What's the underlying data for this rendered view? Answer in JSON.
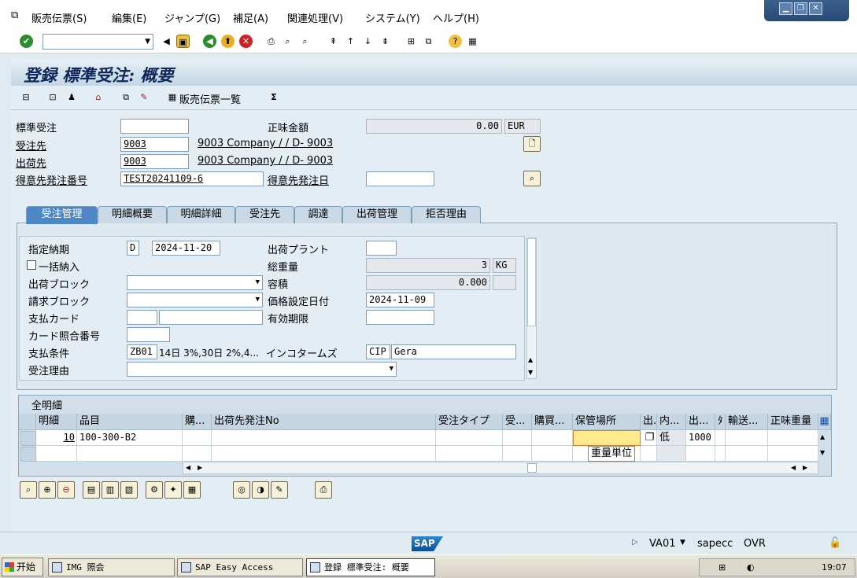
{
  "menu": [
    "販売伝票(S)",
    "編集(E)",
    "ジャンプ(G)",
    "補足(A)",
    "関連処理(V)",
    "システム(Y)",
    "ヘルプ(H)"
  ],
  "page_title": "登録 標準受注: 概要",
  "appbar": {
    "list_label": "販売伝票一覧"
  },
  "header": {
    "order_type_label": "標準受注",
    "order_type_value": "",
    "net_value_label": "正味金額",
    "net_value": "0.00",
    "currency": "EUR",
    "sold_to_label": "受注先",
    "sold_to_value": "9003",
    "sold_to_desc": "9003 Company / / D- 9003",
    "ship_to_label": "出荷先",
    "ship_to_value": "9003",
    "ship_to_desc": "9003 Company / / D- 9003",
    "po_number_label": "得意先発注番号",
    "po_number_value": "TEST20241109-6",
    "po_date_label": "得意先発注日",
    "po_date_value": ""
  },
  "tabs": [
    "受注管理",
    "明細概要",
    "明細詳細",
    "受注先",
    "調達",
    "出荷管理",
    "拒否理由"
  ],
  "sales_tab": {
    "req_delivery_label": "指定納期",
    "req_delivery_type": "D",
    "req_delivery_date": "2024-11-20",
    "plant_label": "出荷プラント",
    "plant_value": "",
    "complete_delivery_label": "一括納入",
    "total_weight_label": "総重量",
    "total_weight": "3",
    "weight_unit": "KG",
    "delivery_block_label": "出荷ブロック",
    "volume_label": "容積",
    "volume": "0.000",
    "volume_unit": "",
    "billing_block_label": "請求ブロック",
    "pricing_date_label": "価格設定日付",
    "pricing_date": "2024-11-09",
    "payment_card_label": "支払カード",
    "valid_to_label": "有効期限",
    "card_verif_label": "カード照合番号",
    "payment_terms_label": "支払条件",
    "payment_terms_code": "ZB01",
    "payment_terms_desc": "14日 3%,30日 2%,4...",
    "incoterms_label": "インコタームズ",
    "incoterms_code": "CIP",
    "incoterms_place": "Gera",
    "order_reason_label": "受注理由"
  },
  "items": {
    "title": "全明細",
    "columns": [
      "明細",
      "品目",
      "購...",
      "出荷先発注No",
      "受注タイプ",
      "受...",
      "購買...",
      "保管場所",
      "出.",
      "内...",
      "出...",
      "ﾀ",
      "輸送...",
      "正味重量"
    ],
    "rows": [
      {
        "item": "10",
        "material": "100-300-B2",
        "inner": "低",
        "qty": "1000"
      }
    ],
    "tooltip": "重量単位"
  },
  "status": {
    "tcode": "VA01",
    "server": "sapecc",
    "mode": "OVR"
  },
  "taskbar": {
    "start": "开始",
    "tasks": [
      "IMG 照会",
      "SAP Easy Access",
      "登録 標準受注: 概要"
    ],
    "time": "19:07"
  }
}
